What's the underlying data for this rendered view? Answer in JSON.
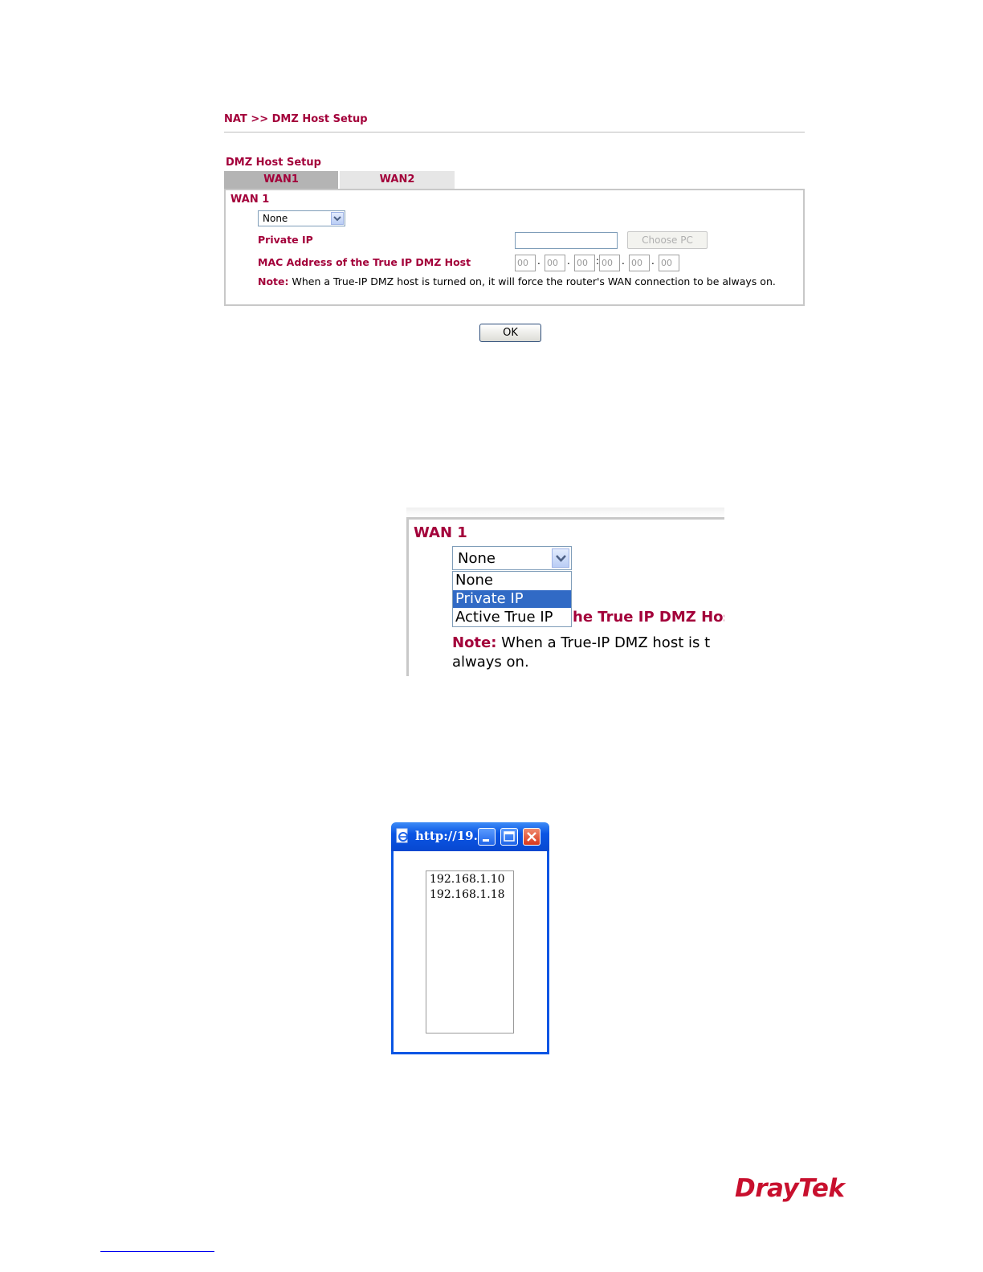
{
  "header": {
    "breadcrumb": "NAT >> DMZ Host Setup",
    "section_title": "DMZ Host Setup"
  },
  "tabs": [
    {
      "label": "WAN1",
      "active": true
    },
    {
      "label": "WAN2",
      "active": false
    }
  ],
  "form": {
    "wan_title": "WAN 1",
    "mode_value": "None",
    "private_ip_label": "Private IP",
    "private_ip_value": "",
    "choose_pc_label": "Choose PC",
    "mac_label": "MAC Address of the True IP DMZ Host",
    "mac_octets": [
      "00",
      "00",
      "00",
      "00",
      "00",
      "00"
    ],
    "mac_separators": [
      ".",
      ".",
      ":",
      ".",
      "."
    ],
    "note_label": "Note:",
    "note_text": " When a True-IP DMZ host is turned on, it will force the router's WAN connection to be always on.",
    "ok_label": "OK"
  },
  "zoom": {
    "wan_title": "WAN 1",
    "selected_value": "None",
    "options": [
      "None",
      "Private IP",
      "Active True IP"
    ],
    "highlighted_option": "Private IP",
    "mac_label_tail": "he True IP DMZ Host",
    "note_label": "Note:",
    "note_line1": " When a True-IP DMZ host is t",
    "note_line2": "always on."
  },
  "popup": {
    "title": "http://19…",
    "items": [
      "192.168.1.10",
      "192.168.1.18"
    ]
  },
  "footer": {
    "logo": "DrayTek"
  },
  "colors": {
    "accent": "#a3003a",
    "selection": "#316ac5",
    "titlebar": "#0a55e4",
    "logo": "#c8102e"
  }
}
